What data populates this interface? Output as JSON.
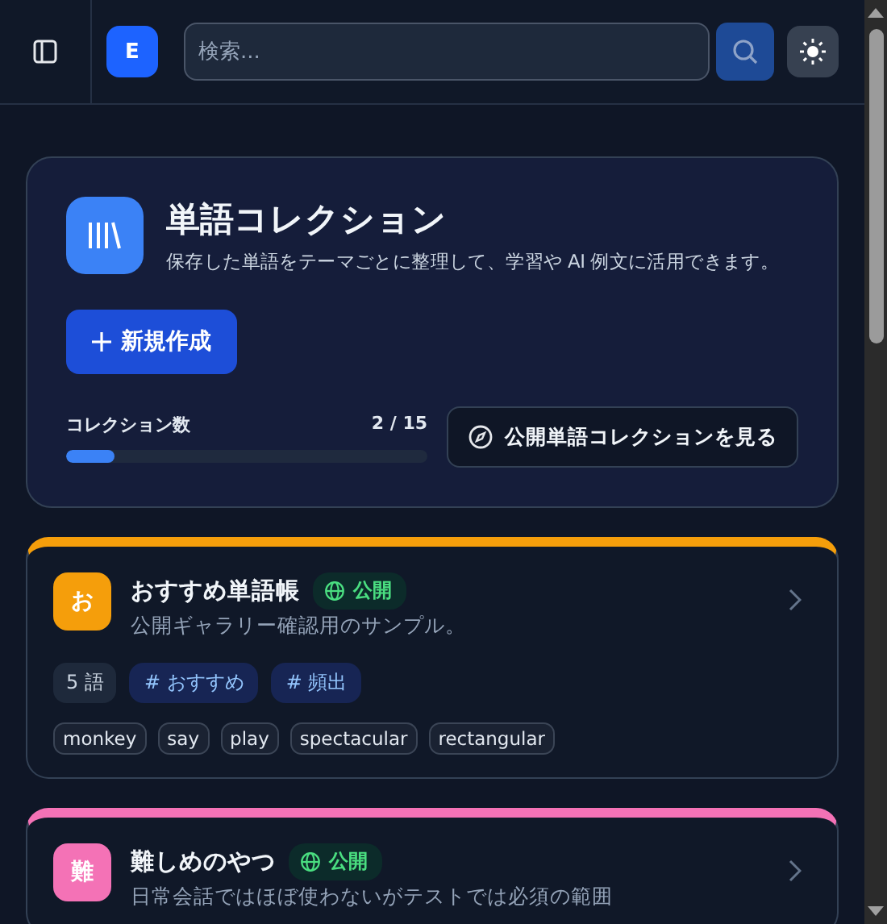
{
  "header": {
    "avatar": "E",
    "search": {
      "placeholder": "検索..."
    }
  },
  "hero": {
    "title": "単語コレクション",
    "description": "保存した単語をテーマごとに整理して、学習や AI 例文に活用できます。",
    "create_button": "新規作成",
    "count_label": "コレクション数",
    "count": "2 / 15",
    "level": 0.1333,
    "public_button": "公開単語コレクションを見る"
  },
  "collections": [
    {
      "initial": "お",
      "color": "#f59e0b",
      "title": "おすすめ単語帳",
      "visibility": "公開",
      "description": "公開ギャラリー確認用のサンプル。",
      "word_count": "5 語",
      "tags": [
        "# おすすめ",
        "# 頻出"
      ],
      "words": [
        "monkey",
        "say",
        "play",
        "spectacular",
        "rectangular"
      ]
    },
    {
      "initial": "難",
      "color": "#f472b6",
      "title": "難しめのやつ",
      "visibility": "公開",
      "description": "日常会話ではほぼ使わないがテストでは必須の範囲"
    }
  ]
}
